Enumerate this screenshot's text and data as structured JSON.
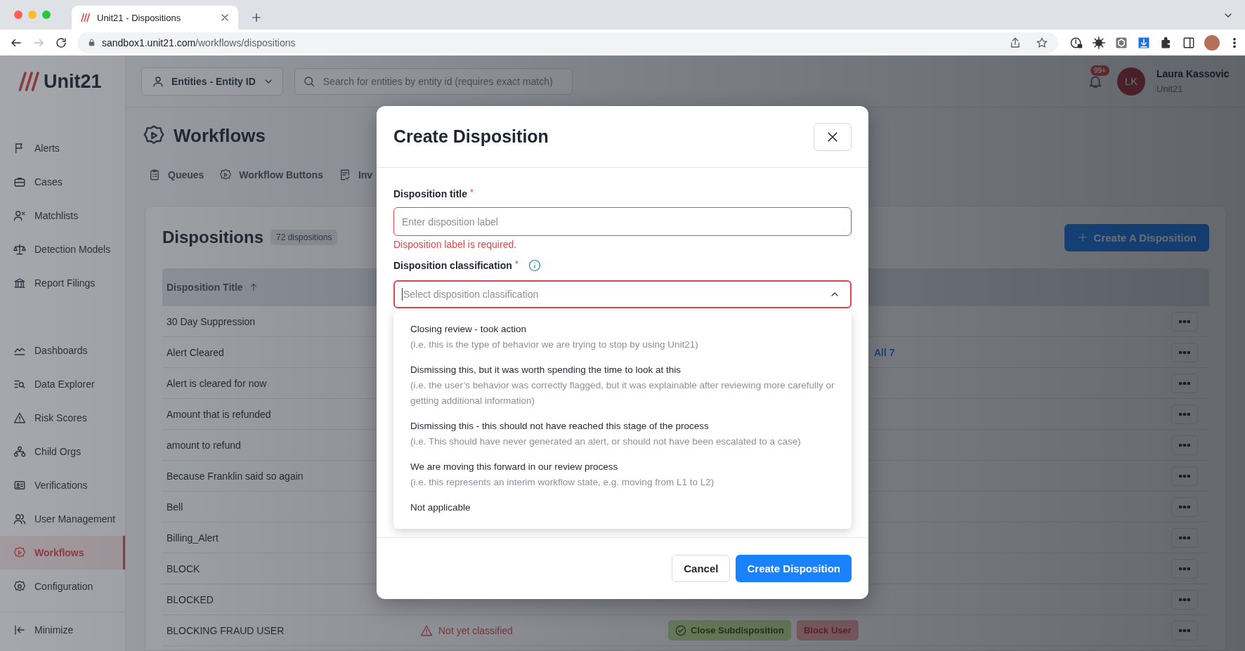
{
  "browser": {
    "tab_title": "Unit21 - Dispositions",
    "url_host": "sandbox1.unit21.com",
    "url_path": "/workflows/dispositions"
  },
  "app": {
    "logo": "Unit21",
    "entity_selector": "Entities - Entity ID",
    "search": {
      "placeholder": "Search for entities by entity id (requires exact match)"
    },
    "notification_badge": "99+",
    "user": {
      "initials": "LK",
      "name": "Laura Kassovic",
      "org": "Unit21"
    }
  },
  "sidebar": {
    "groups": [
      [
        {
          "label": "Alerts",
          "selected": false
        },
        {
          "label": "Cases",
          "selected": false
        },
        {
          "label": "Matchlists",
          "selected": false
        },
        {
          "label": "Detection Models",
          "selected": false
        },
        {
          "label": "Report Filings",
          "selected": false
        }
      ],
      [
        {
          "label": "Dashboards",
          "selected": false
        },
        {
          "label": "Data Explorer",
          "selected": false
        },
        {
          "label": "Risk Scores",
          "selected": false
        },
        {
          "label": "Child Orgs",
          "selected": false
        },
        {
          "label": "Verifications",
          "selected": false
        },
        {
          "label": "User Management",
          "selected": false
        },
        {
          "label": "Workflows",
          "selected": true
        },
        {
          "label": "Configuration",
          "selected": false
        }
      ]
    ],
    "minimize": "Minimize"
  },
  "page": {
    "title": "Workflows",
    "tabs": [
      {
        "label": "Queues"
      },
      {
        "label": "Workflow Buttons"
      },
      {
        "label": "Inv"
      }
    ]
  },
  "dispositions": {
    "title": "Dispositions",
    "count": "72 dispositions",
    "create_button": "Create A Disposition",
    "columns": [
      "Disposition Title"
    ],
    "rows": [
      {
        "title": "30 Day Suppression"
      },
      {
        "title": "Alert Cleared",
        "link": "All 7"
      },
      {
        "title": "Alert is cleared for now"
      },
      {
        "title": "Amount that is refunded"
      },
      {
        "title": "amount to refund"
      },
      {
        "title": "Because Franklin said so again"
      },
      {
        "title": "Bell"
      },
      {
        "title": "Billing_Alert"
      },
      {
        "title": "BLOCK"
      },
      {
        "title": "BLOCKED"
      },
      {
        "title": "BLOCKING FRAUD USER",
        "classification": "Not yet classified",
        "actions": [
          {
            "label": "Close Subdisposition",
            "kind": "close"
          },
          {
            "label": "Block User",
            "kind": "block"
          }
        ]
      }
    ]
  },
  "modal": {
    "title": "Create Disposition",
    "title_field": {
      "label": "Disposition title",
      "required_mark": "*",
      "placeholder": "Enter disposition label",
      "error": "Disposition label is required."
    },
    "classification_field": {
      "label": "Disposition classification",
      "required_mark": "*",
      "placeholder": "Select disposition classification",
      "expanded": true,
      "options": [
        {
          "title": "Closing review - took action",
          "description": "(i.e. this is the type of behavior we are trying to stop by using Unit21)"
        },
        {
          "title": "Dismissing this, but it was worth spending the time to look at this",
          "description": "(i.e. the user’s behavior was correctly flagged, but it was explainable after reviewing more carefully or getting additional information)"
        },
        {
          "title": "Dismissing this - this should not have reached this stage of the process",
          "description": "(i.e. This should have never generated an alert, or should not have been escalated to a case)"
        },
        {
          "title": "We are moving this forward in our review process",
          "description": "(i.e. this represents an interim workflow state, e.g. moving from L1 to L2)"
        },
        {
          "title": "Not applicable"
        }
      ]
    },
    "buttons": [
      {
        "label": "Cancel",
        "kind": "secondary"
      },
      {
        "label": "Create Disposition",
        "kind": "primary"
      }
    ]
  }
}
